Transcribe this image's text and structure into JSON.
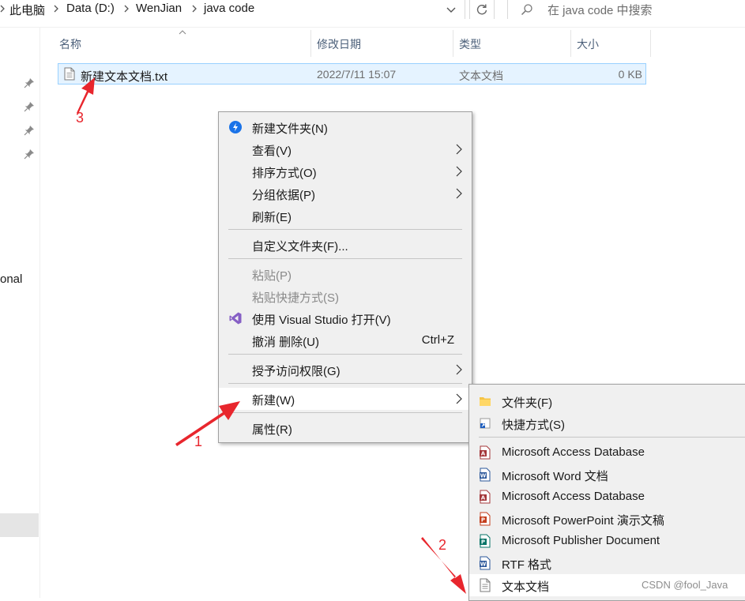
{
  "addressbar": {
    "crumbs": [
      "此电脑",
      "Data (D:)",
      "WenJian",
      "java code"
    ],
    "search_placeholder": "在 java code 中搜索"
  },
  "navpane": {
    "partial_label": "onal"
  },
  "filelist": {
    "columns": {
      "name": "名称",
      "date": "修改日期",
      "type": "类型",
      "size": "大小"
    },
    "files": [
      {
        "name": "新建文本文档.txt",
        "date": "2022/7/11 15:07",
        "type": "文本文档",
        "size": "0 KB"
      }
    ]
  },
  "context_menu": {
    "items": [
      {
        "label": "新建文件夹(N)"
      },
      {
        "label": "查看(V)"
      },
      {
        "label": "排序方式(O)"
      },
      {
        "label": "分组依据(P)"
      },
      {
        "label": "刷新(E)"
      },
      {
        "label": "自定义文件夹(F)..."
      },
      {
        "label": "粘贴(P)"
      },
      {
        "label": "粘贴快捷方式(S)"
      },
      {
        "label": "使用 Visual Studio 打开(V)"
      },
      {
        "label": "撤消 删除(U)",
        "shortcut": "Ctrl+Z"
      },
      {
        "label": "授予访问权限(G)"
      },
      {
        "label": "新建(W)"
      },
      {
        "label": "属性(R)"
      }
    ]
  },
  "new_submenu": {
    "items": [
      {
        "label": "文件夹(F)"
      },
      {
        "label": "快捷方式(S)"
      },
      {
        "label": "Microsoft Access Database"
      },
      {
        "label": "Microsoft Word 文档"
      },
      {
        "label": "Microsoft Access Database"
      },
      {
        "label": "Microsoft PowerPoint 演示文稿"
      },
      {
        "label": "Microsoft Publisher Document"
      },
      {
        "label": "RTF 格式"
      },
      {
        "label": "文本文档"
      }
    ]
  },
  "annotations": {
    "step1": "1",
    "step2": "2",
    "step3": "3"
  },
  "watermark": "CSDN @fool_Java",
  "colors": {
    "selection_bg": "#e5f3ff",
    "selection_border": "#99d1ff",
    "menu_bg": "#f0f0f0",
    "annotation_red": "#e8262d"
  }
}
